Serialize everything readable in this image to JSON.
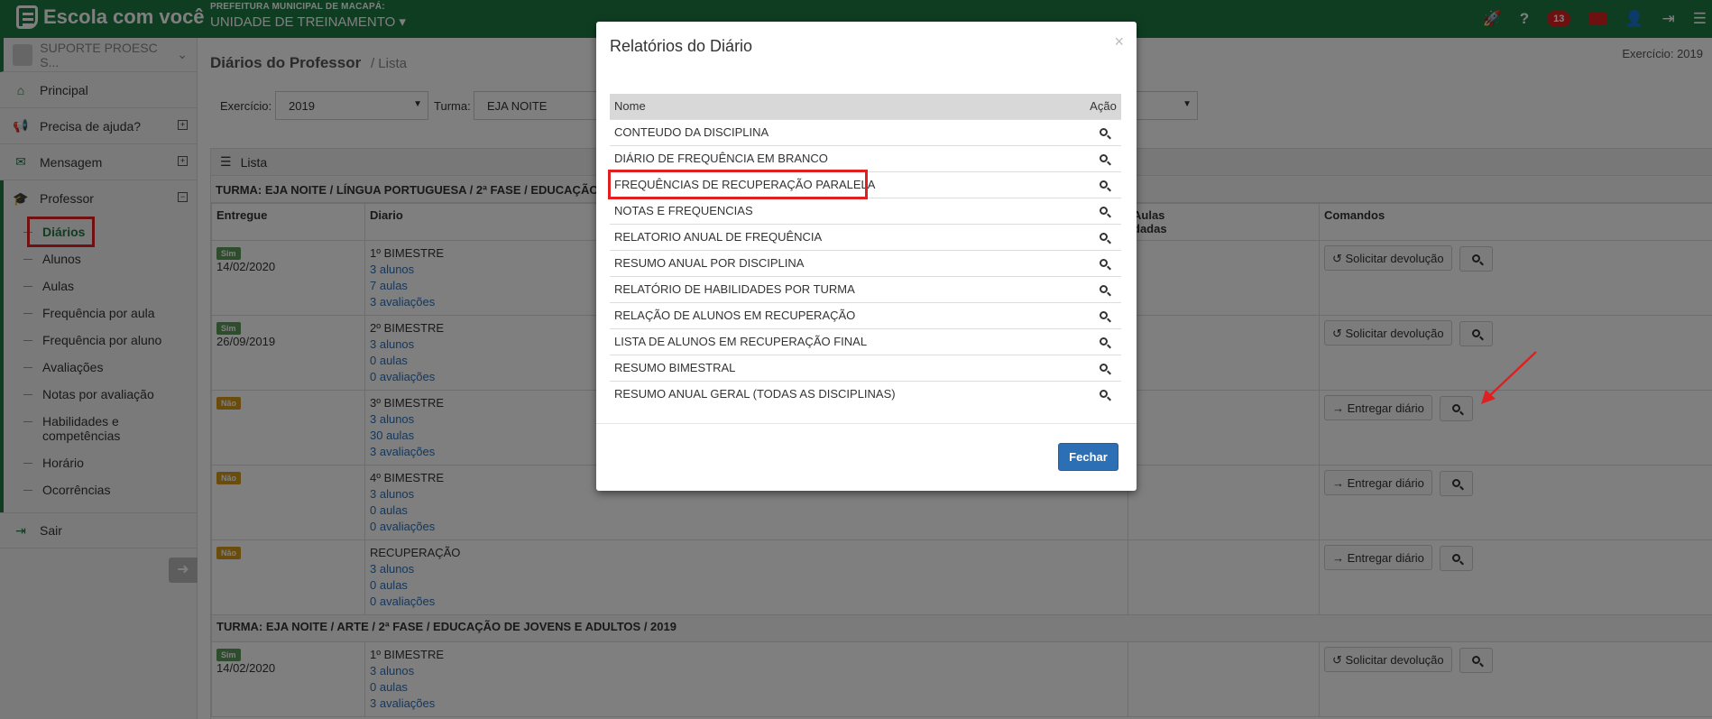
{
  "header": {
    "brand": "Escola com você",
    "prefeitura": "PREFEITURA MUNICIPAL DE MACAPÁ:",
    "unidade": "UNIDADE DE TREINAMENTO",
    "notifications_count": "13",
    "icons": [
      "rocket-icon",
      "help-icon",
      "bell-badge",
      "mail-icon",
      "user-icon",
      "logout-icon",
      "menu-icon"
    ]
  },
  "sidebar": {
    "user": "SUPORTE PROESC S...",
    "items": [
      {
        "label": "Principal",
        "icon": "home-icon"
      },
      {
        "label": "Precisa de ajuda?",
        "icon": "megaphone-icon"
      },
      {
        "label": "Mensagem",
        "icon": "envelope-icon"
      },
      {
        "label": "Professor",
        "icon": "graduation-cap-icon"
      }
    ],
    "sub_items": [
      "Diários",
      "Alunos",
      "Aulas",
      "Frequência por aula",
      "Frequência por aluno",
      "Avaliações",
      "Notas por avaliação",
      "Habilidades e competências",
      "Horário",
      "Ocorrências"
    ],
    "logout": "Sair"
  },
  "page": {
    "title": "Diários do Professor",
    "crumb": "Lista",
    "exercicio_top": "Exercício: 2019",
    "filter_exercicio_label": "Exercício:",
    "filter_exercicio_value": "2019",
    "filter_turma_label": "Turma:",
    "filter_turma_value": "EJA NOITE",
    "panel_title": "Lista",
    "turma1": "TURMA: EJA NOITE / LÍNGUA PORTUGUESA / 2ª FASE / EDUCAÇÃO",
    "turma2": "TURMA: EJA NOITE / ARTE / 2ª FASE / EDUCAÇÃO DE JOVENS E ADULTOS / 2019",
    "columns": {
      "entregue": "Entregue",
      "diario": "Diario",
      "aulas": "Aulas",
      "aulas2": "dadas",
      "comandos": "Comandos"
    },
    "rows": [
      {
        "tag": "Sim",
        "date": "14/02/2020",
        "bim": "1º BIMESTRE",
        "alunos": "3 alunos",
        "aulas": "7 aulas",
        "aval": "3 avaliações",
        "cmd": "Solicitar devolução"
      },
      {
        "tag": "Sim",
        "date": "26/09/2019",
        "bim": "2º BIMESTRE",
        "alunos": "3 alunos",
        "aulas": "0 aulas",
        "aval": "0 avaliações",
        "cmd": "Solicitar devolução"
      },
      {
        "tag": "Não",
        "date": "",
        "bim": "3º BIMESTRE",
        "alunos": "3 alunos",
        "aulas": "30 aulas",
        "aval": "3 avaliações",
        "cmd": "Entregar diário"
      },
      {
        "tag": "Não",
        "date": "",
        "bim": "4º BIMESTRE",
        "alunos": "3 alunos",
        "aulas": "0 aulas",
        "aval": "0 avaliações",
        "cmd": "Entregar diário"
      },
      {
        "tag": "Não",
        "date": "",
        "bim": "RECUPERAÇÃO",
        "alunos": "3 alunos",
        "aulas": "0 aulas",
        "aval": "0 avaliações",
        "cmd": "Entregar diário"
      }
    ],
    "row_t2": {
      "tag": "Sim",
      "date": "14/02/2020",
      "bim": "1º BIMESTRE",
      "alunos": "3 alunos",
      "aulas": "0 aulas",
      "aval": "3 avaliações",
      "cmd": "Solicitar devolução"
    }
  },
  "modal": {
    "title": "Relatórios do Diário",
    "close": "×",
    "col_nome": "Nome",
    "col_acao": "Ação",
    "reports": [
      "CONTEUDO DA DISCIPLINA",
      "DIÁRIO DE FREQUÊNCIA EM BRANCO",
      "FREQUÊNCIAS DE RECUPERAÇÃO PARALELA",
      "NOTAS E FREQUENCIAS",
      "RELATORIO ANUAL DE FREQUÊNCIA",
      "RESUMO ANUAL POR DISCIPLINA",
      "RELATÓRIO DE HABILIDADES POR TURMA",
      "RELAÇÃO DE ALUNOS EM RECUPERAÇÃO",
      "LISTA DE ALUNOS EM RECUPERAÇÃO FINAL",
      "RESUMO BIMESTRAL",
      "RESUMO ANUAL GERAL (TODAS AS DISCIPLINAS)"
    ],
    "fechar": "Fechar"
  },
  "colors": {
    "brand": "#1f7a45",
    "highlight": "#e02020",
    "primary_button": "#2d6fb5"
  }
}
